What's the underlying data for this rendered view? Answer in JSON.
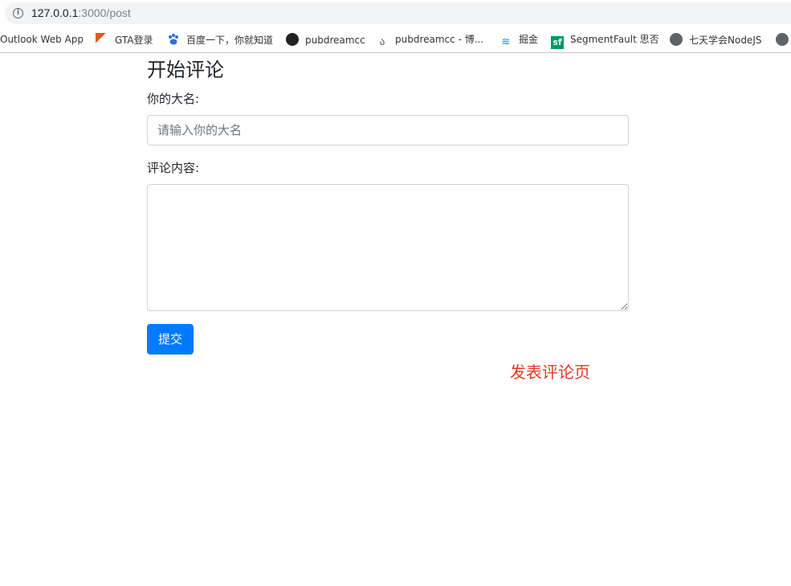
{
  "browser": {
    "url_host": "127.0.0.1",
    "url_path": ":3000/post"
  },
  "bookmarks": [
    {
      "label": "Outlook Web App",
      "icon": "none"
    },
    {
      "label": "GTA登录",
      "icon": "gta-icon"
    },
    {
      "label": "百度一下，你就知道",
      "icon": "baidu-paw-icon"
    },
    {
      "label": "pubdreamcc",
      "icon": "github-icon"
    },
    {
      "label": "pubdreamcc - 博...",
      "icon": "cnblogs-icon"
    },
    {
      "label": "掘金",
      "icon": "juejin-icon"
    },
    {
      "label": "SegmentFault 思否",
      "icon": "segmentfault-icon"
    },
    {
      "label": "七天学会NodeJS",
      "icon": "globe-icon"
    }
  ],
  "form": {
    "title": "开始评论",
    "name_label": "你的大名:",
    "name_placeholder": "请输入你的大名",
    "name_value": "",
    "content_label": "评论内容:",
    "content_value": "",
    "submit_label": "提交"
  },
  "caption": "发表评论页",
  "colors": {
    "primary": "#007bff",
    "caption": "#e03a24"
  }
}
